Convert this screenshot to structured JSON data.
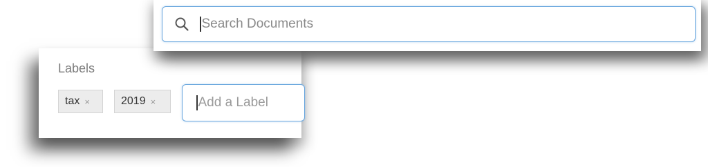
{
  "search": {
    "placeholder": "Search Documents",
    "icon": "search-icon"
  },
  "labels": {
    "title": "Labels",
    "chips": [
      {
        "text": "tax",
        "remove": "×"
      },
      {
        "text": "2019",
        "remove": "×"
      }
    ],
    "input_placeholder": "Add a Label"
  },
  "colors": {
    "focus_border": "#6aa7de",
    "chip_background": "#ececec",
    "placeholder_text": "#8a8a8a"
  }
}
